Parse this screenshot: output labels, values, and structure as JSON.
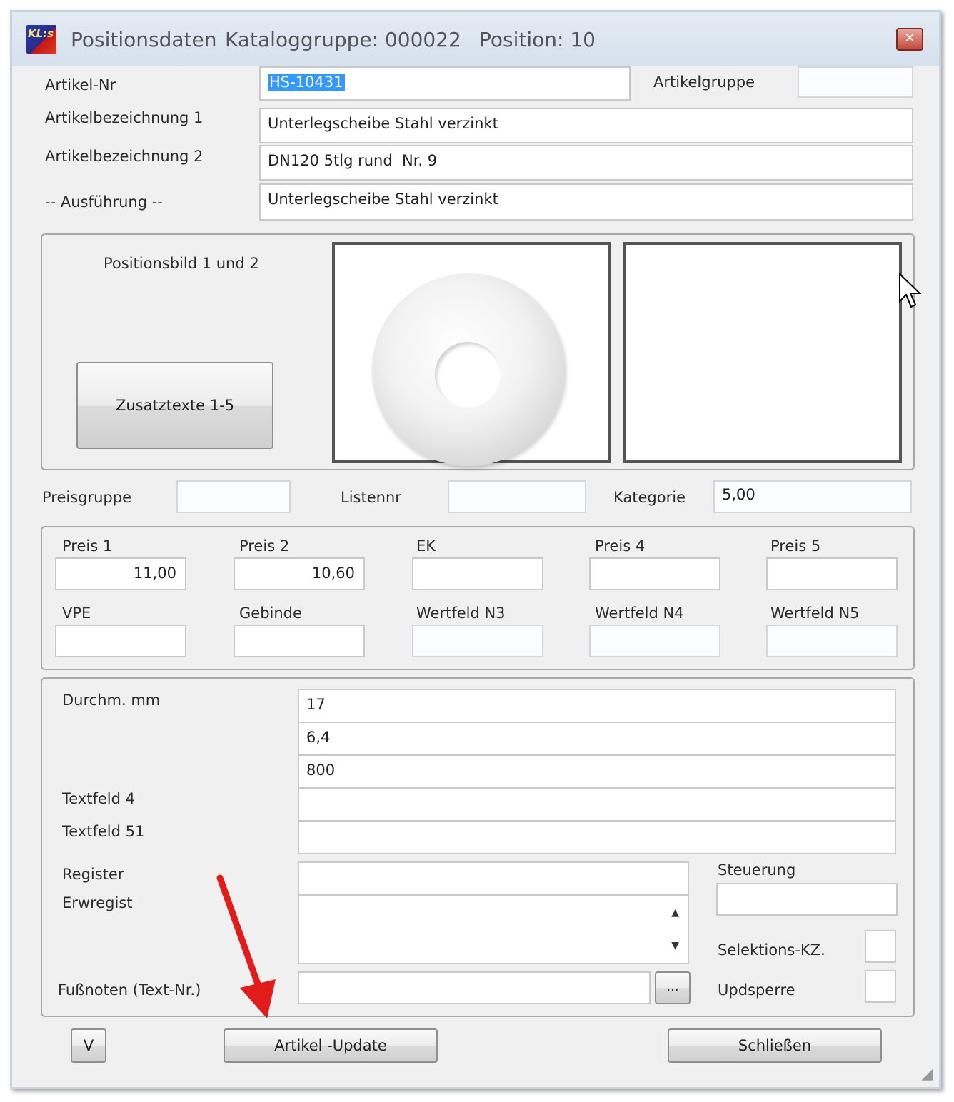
{
  "window": {
    "title": "Positionsdaten",
    "catalog_group_label": "Kataloggruppe: 000022",
    "position_label": "Position: 10",
    "logo_text": "KL:s",
    "close_icon": "close-icon"
  },
  "fields": {
    "artikel_nr": {
      "label": "Artikel-Nr",
      "value": "HS-10431"
    },
    "artikelgruppe": {
      "label": "Artikelgruppe",
      "value": ""
    },
    "bezeichnung1": {
      "label": "Artikelbezeichnung 1",
      "value": "Unterlegscheibe Stahl verzinkt"
    },
    "bezeichnung2": {
      "label": "Artikelbezeichnung 2",
      "value": "DN120 5tlg rund  Nr. 9"
    },
    "ausfuehrung": {
      "label": "-- Ausführung --",
      "value": "Unterlegscheibe Stahl verzinkt"
    }
  },
  "images": {
    "label": "Positionsbild 1 und 2",
    "zusatz_button": "Zusatztexte 1-5"
  },
  "pricing_row": {
    "preisgruppe": {
      "label": "Preisgruppe",
      "value": ""
    },
    "listennr": {
      "label": "Listennr",
      "value": ""
    },
    "kategorie": {
      "label": "Kategorie",
      "value": "5,00"
    }
  },
  "prices": {
    "preis1": {
      "label": "Preis 1",
      "value": "11,00"
    },
    "preis2": {
      "label": "Preis 2",
      "value": "10,60"
    },
    "ek": {
      "label": "EK",
      "value": ""
    },
    "preis4": {
      "label": "Preis 4",
      "value": ""
    },
    "preis5": {
      "label": "Preis 5",
      "value": ""
    },
    "vpe": {
      "label": "VPE",
      "value": ""
    },
    "gebinde": {
      "label": "Gebinde",
      "value": ""
    },
    "wertfeld_n3": {
      "label": "Wertfeld N3",
      "value": ""
    },
    "wertfeld_n4": {
      "label": "Wertfeld N4",
      "value": ""
    },
    "wertfeld_n5": {
      "label": "Wertfeld N5",
      "value": ""
    }
  },
  "details": {
    "durchm_label": "Durchm. mm",
    "rows": [
      "17",
      "6,4",
      "800",
      "",
      ""
    ],
    "textfeld4_label": "Textfeld 4",
    "textfeld51_label": "Textfeld 51",
    "register_label": "Register",
    "register_value": "",
    "erwregist_label": "Erwregist",
    "steuerung_label": "Steuerung",
    "steuerung_value": "",
    "selektions_label": "Selektions-KZ.",
    "updsperre_label": "Updsperre",
    "fussnoten_label": "Fußnoten (Text-Nr.)",
    "fussnoten_value": "",
    "browse_button": "..."
  },
  "footer": {
    "v_button": "V",
    "update_button": "Artikel -Update",
    "close_button": "Schließen"
  },
  "colors": {
    "annotation_arrow": "#e21b1b",
    "selection": "#3399ff"
  }
}
